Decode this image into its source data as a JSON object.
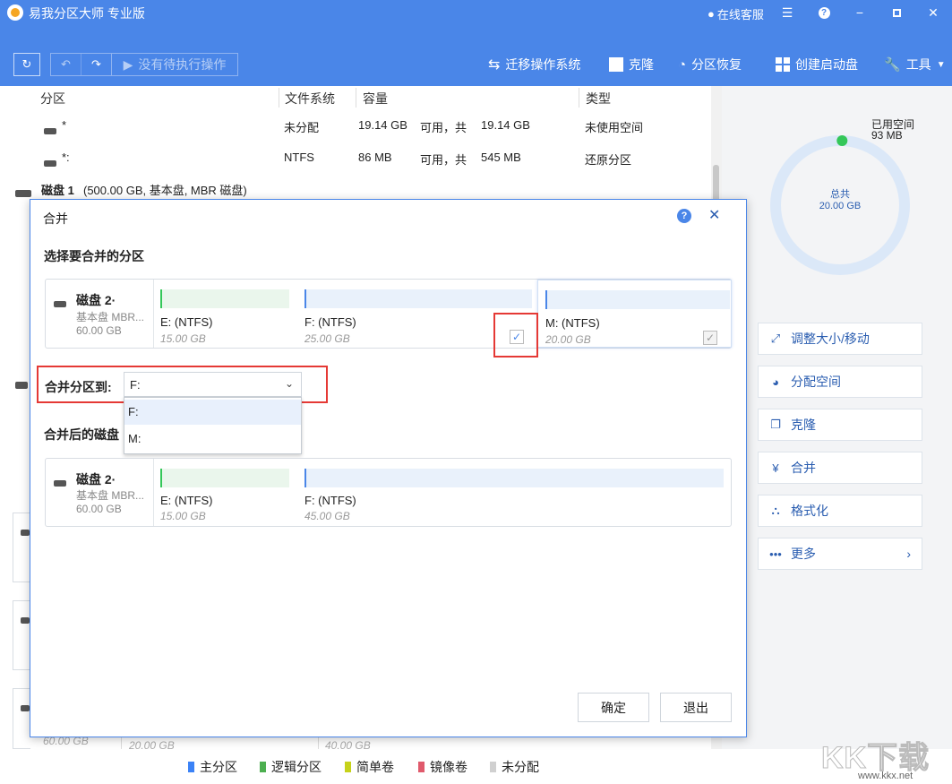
{
  "app": {
    "title": "易我分区大师 专业版",
    "online_support": "在线客服"
  },
  "toolbar": {
    "pending": "没有待执行操作",
    "migrate_os": "迁移操作系统",
    "clone": "克隆",
    "recover": "分区恢复",
    "boot_disk": "创建启动盘",
    "tools": "工具"
  },
  "table": {
    "headers": [
      "分区",
      "文件系统",
      "容量",
      "类型"
    ],
    "rows": [
      {
        "name": "*",
        "fs": "未分配",
        "size": "19.14 GB",
        "free_label": "可用，共",
        "total": "19.14 GB",
        "type": "未使用空间"
      },
      {
        "name": "*:",
        "fs": "NTFS",
        "size": "86 MB",
        "free_label": "可用，共",
        "total": "545 MB",
        "type": "还原分区"
      }
    ],
    "disk1": {
      "name": "磁盘 1",
      "detail": "(500.00 GB, 基本盘, MBR 磁盘)"
    },
    "bg_fragments": [
      "60.00 GB",
      "20.00 GB",
      "40.00 GB"
    ]
  },
  "right": {
    "used_label": "已用空间",
    "used_value": "93 MB",
    "total_label": "总共",
    "total_value": "20.00 GB",
    "used_fraction": 0.005,
    "actions": [
      "调整大小/移动",
      "分配空间",
      "克隆",
      "合并",
      "格式化",
      "更多"
    ]
  },
  "legend": [
    {
      "label": "主分区",
      "color": "#3b82f6"
    },
    {
      "label": "逻辑分区",
      "color": "#4caf50"
    },
    {
      "label": "简单卷",
      "color": "#c6d21a"
    },
    {
      "label": "镜像卷",
      "color": "#e05a6c"
    },
    {
      "label": "未分配",
      "color": "#d0d0d0"
    }
  ],
  "dialog": {
    "title": "合并",
    "section1": "选择要合并的分区",
    "disk": {
      "name": "磁盘 2·",
      "type": "基本盘 MBR...",
      "size": "60.00 GB"
    },
    "partitions": [
      {
        "label": "E: (NTFS)",
        "size": "15.00 GB"
      },
      {
        "label": "F: (NTFS)",
        "size": "25.00 GB",
        "checked": "✓"
      },
      {
        "label": "M: (NTFS)",
        "size": "20.00 GB",
        "checked": "✓"
      }
    ],
    "merge_to_label": "合并分区到:",
    "merge_to_value": "F:",
    "options": [
      "F:",
      "M:"
    ],
    "section2": "合并后的磁盘",
    "after": {
      "disk": {
        "name": "磁盘 2·",
        "type": "基本盘 MBR...",
        "size": "60.00 GB"
      },
      "partitions": [
        {
          "label": "E: (NTFS)",
          "size": "15.00 GB"
        },
        {
          "label": "F: (NTFS)",
          "size": "45.00 GB"
        }
      ]
    },
    "ok": "确定",
    "exit": "退出"
  },
  "watermark": {
    "brand": "KK下载",
    "url": "www.kkx.net"
  }
}
